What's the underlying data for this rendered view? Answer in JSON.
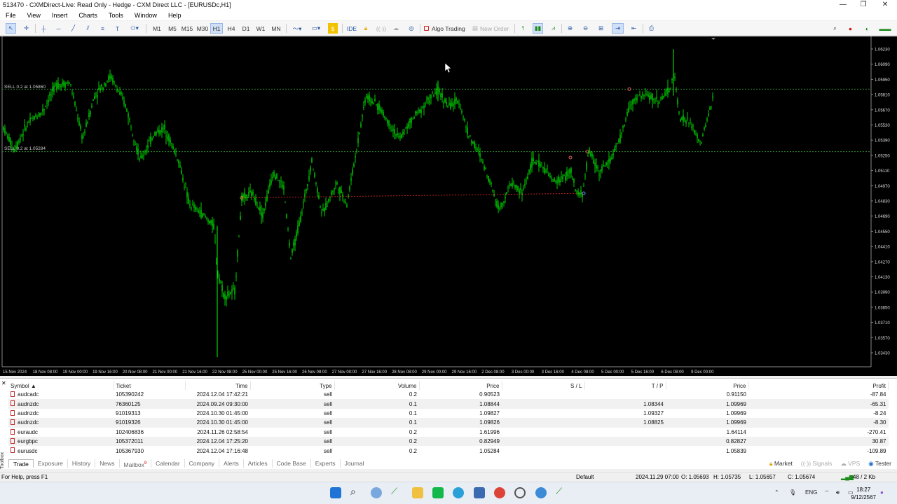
{
  "window": {
    "title": "513470 - CXMDirect-Live: Read Only - Hedge - CXM Direct LLC - [EURUSDc,H1]"
  },
  "menu": [
    "File",
    "View",
    "Insert",
    "Charts",
    "Tools",
    "Window",
    "Help"
  ],
  "toolbar": {
    "timeframes": [
      "M1",
      "M5",
      "M15",
      "M30",
      "H1",
      "H4",
      "D1",
      "W1",
      "MN"
    ],
    "selected_timeframe": "H1",
    "ide_label": "IDE",
    "algo_label": "Algo Trading",
    "new_order_label": "New Order"
  },
  "chart": {
    "symbol": "EURUSDc",
    "timeframe": "H1",
    "line_label_1": "SELL 0.2 at 1.05860",
    "line_label_2": "SELL 0.2 at 1.05284",
    "price_ticks": [
      "1.06230",
      "1.06090",
      "1.05950",
      "1.05810",
      "1.05670",
      "1.05530",
      "1.05390",
      "1.05250",
      "1.05110",
      "1.04970",
      "1.04830",
      "1.04690",
      "1.04550",
      "1.04410",
      "1.04270",
      "1.04130",
      "1.03990",
      "1.03850",
      "1.03710",
      "1.03570",
      "1.03430"
    ],
    "time_ticks": [
      "15 Nov 2024",
      "18 Nov 08:00",
      "19 Nov 00:00",
      "19 Nov 16:00",
      "20 Nov 08:00",
      "21 Nov 00:00",
      "21 Nov 16:00",
      "22 Nov 08:00",
      "25 Nov 00:00",
      "25 Nov 16:00",
      "26 Nov 08:00",
      "27 Nov 00:00",
      "27 Nov 16:00",
      "28 Nov 08:00",
      "29 Nov 00:00",
      "29 Nov 16:00",
      "2 Dec 08:00",
      "3 Dec 00:00",
      "3 Dec 16:00",
      "4 Dec 08:00",
      "5 Dec 00:00",
      "5 Dec 16:00",
      "6 Dec 08:00",
      "9 Dec 00:00"
    ],
    "colors": {
      "background": "#000000",
      "candles": "#00ff00",
      "trade_line": "#2e8b2e",
      "loss_line": "#c02020"
    }
  },
  "trades": {
    "columns": [
      "Symbol",
      "Ticket",
      "Time",
      "Type",
      "Volume",
      "Price",
      "S / L",
      "T / P",
      "Price",
      "Profit"
    ],
    "rows": [
      {
        "symbol": "audcadc",
        "ticket": "105390242",
        "time": "2024.12.04 17:42:21",
        "type": "sell",
        "volume": "0.2",
        "price": "0.90523",
        "sl": "",
        "tp": "",
        "cur": "0.91150",
        "profit": "-87.84",
        "sign": "neg"
      },
      {
        "symbol": "audnzdc",
        "ticket": "76360125",
        "time": "2024.09.24 09:30:00",
        "type": "sell",
        "volume": "0.1",
        "price": "1.08844",
        "sl": "",
        "tp": "1.08344",
        "cur": "1.09969",
        "profit": "-65.31",
        "sign": "neg"
      },
      {
        "symbol": "audnzdc",
        "ticket": "91019313",
        "time": "2024.10.30 01:45:00",
        "type": "sell",
        "volume": "0.1",
        "price": "1.09827",
        "sl": "",
        "tp": "1.09327",
        "cur": "1.09969",
        "profit": "-8.24",
        "sign": "neg"
      },
      {
        "symbol": "audnzdc",
        "ticket": "91019326",
        "time": "2024.10.30 01:45:00",
        "type": "sell",
        "volume": "0.1",
        "price": "1.09826",
        "sl": "",
        "tp": "1.08825",
        "cur": "1.09969",
        "profit": "-8.30",
        "sign": "neg"
      },
      {
        "symbol": "euraudc",
        "ticket": "102406836",
        "time": "2024.11.26 02:58:54",
        "type": "sell",
        "volume": "0.2",
        "price": "1.61996",
        "sl": "",
        "tp": "",
        "cur": "1.64114",
        "profit": "-270.41",
        "sign": "neg"
      },
      {
        "symbol": "eurgbpc",
        "ticket": "105372011",
        "time": "2024.12.04 17:25:20",
        "type": "sell",
        "volume": "0.2",
        "price": "0.82949",
        "sl": "",
        "tp": "",
        "cur": "0.82827",
        "profit": "30.87",
        "sign": "pos"
      },
      {
        "symbol": "eurusdc",
        "ticket": "105367930",
        "time": "2024.12.04 17:16:48",
        "type": "sell",
        "volume": "0.2",
        "price": "1.05284",
        "sl": "",
        "tp": "",
        "cur": "1.05839",
        "profit": "-109.89",
        "sign": "neg"
      }
    ]
  },
  "tabs": [
    "Trade",
    "Exposure",
    "History",
    "News",
    "Mailbox",
    "Calendar",
    "Company",
    "Alerts",
    "Articles",
    "Code Base",
    "Experts",
    "Journal"
  ],
  "mailbox_badge": "9",
  "toolbox_label": "Toolbox",
  "terminal_right": [
    "Market",
    "Signals",
    "VPS",
    "Tester"
  ],
  "status": {
    "help": "For Help, press F1",
    "profile": "Default",
    "datetime": "2024.11.29 07:00",
    "open": "O: 1.05693",
    "high": "H: 1.05735",
    "low": "L: 1.05657",
    "close": "C: 1.05674",
    "traffic": "48 / 2 Kb"
  },
  "taskbar": {
    "lang": "ENG",
    "time": "18:27",
    "date": "9/12/2567"
  }
}
